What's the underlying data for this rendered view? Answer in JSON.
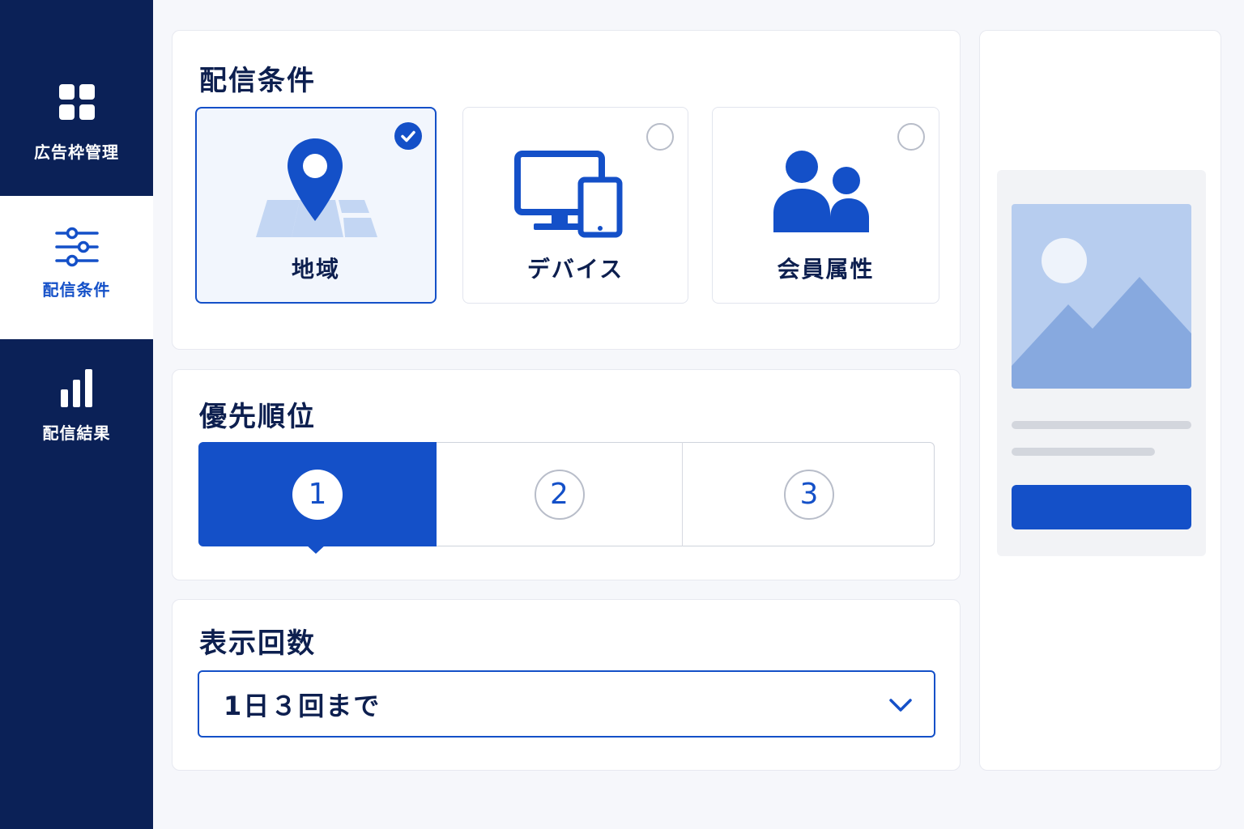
{
  "colors": {
    "sidebar_bg": "#0b2157",
    "accent": "#1450c8",
    "page_bg": "#f6f7fb",
    "text_dark": "#0d1f4f"
  },
  "sidebar": {
    "items": [
      {
        "label": "広告枠管理",
        "icon": "grid-icon",
        "active": false
      },
      {
        "label": "配信条件",
        "icon": "sliders-icon",
        "active": true
      },
      {
        "label": "配信結果",
        "icon": "bar-chart-icon",
        "active": false
      }
    ]
  },
  "delivery_conditions": {
    "title": "配信条件",
    "options": [
      {
        "label": "地域",
        "icon": "map-pin-icon",
        "selected": true
      },
      {
        "label": "デバイス",
        "icon": "devices-icon",
        "selected": false
      },
      {
        "label": "会員属性",
        "icon": "users-icon",
        "selected": false
      }
    ]
  },
  "priority": {
    "title": "優先順位",
    "options": [
      {
        "label": "1",
        "selected": true
      },
      {
        "label": "2",
        "selected": false
      },
      {
        "label": "3",
        "selected": false
      }
    ]
  },
  "display_count": {
    "title": "表示回数",
    "selected_value": "1日３回まで"
  },
  "preview": {
    "image_icon": "image-placeholder-icon"
  }
}
